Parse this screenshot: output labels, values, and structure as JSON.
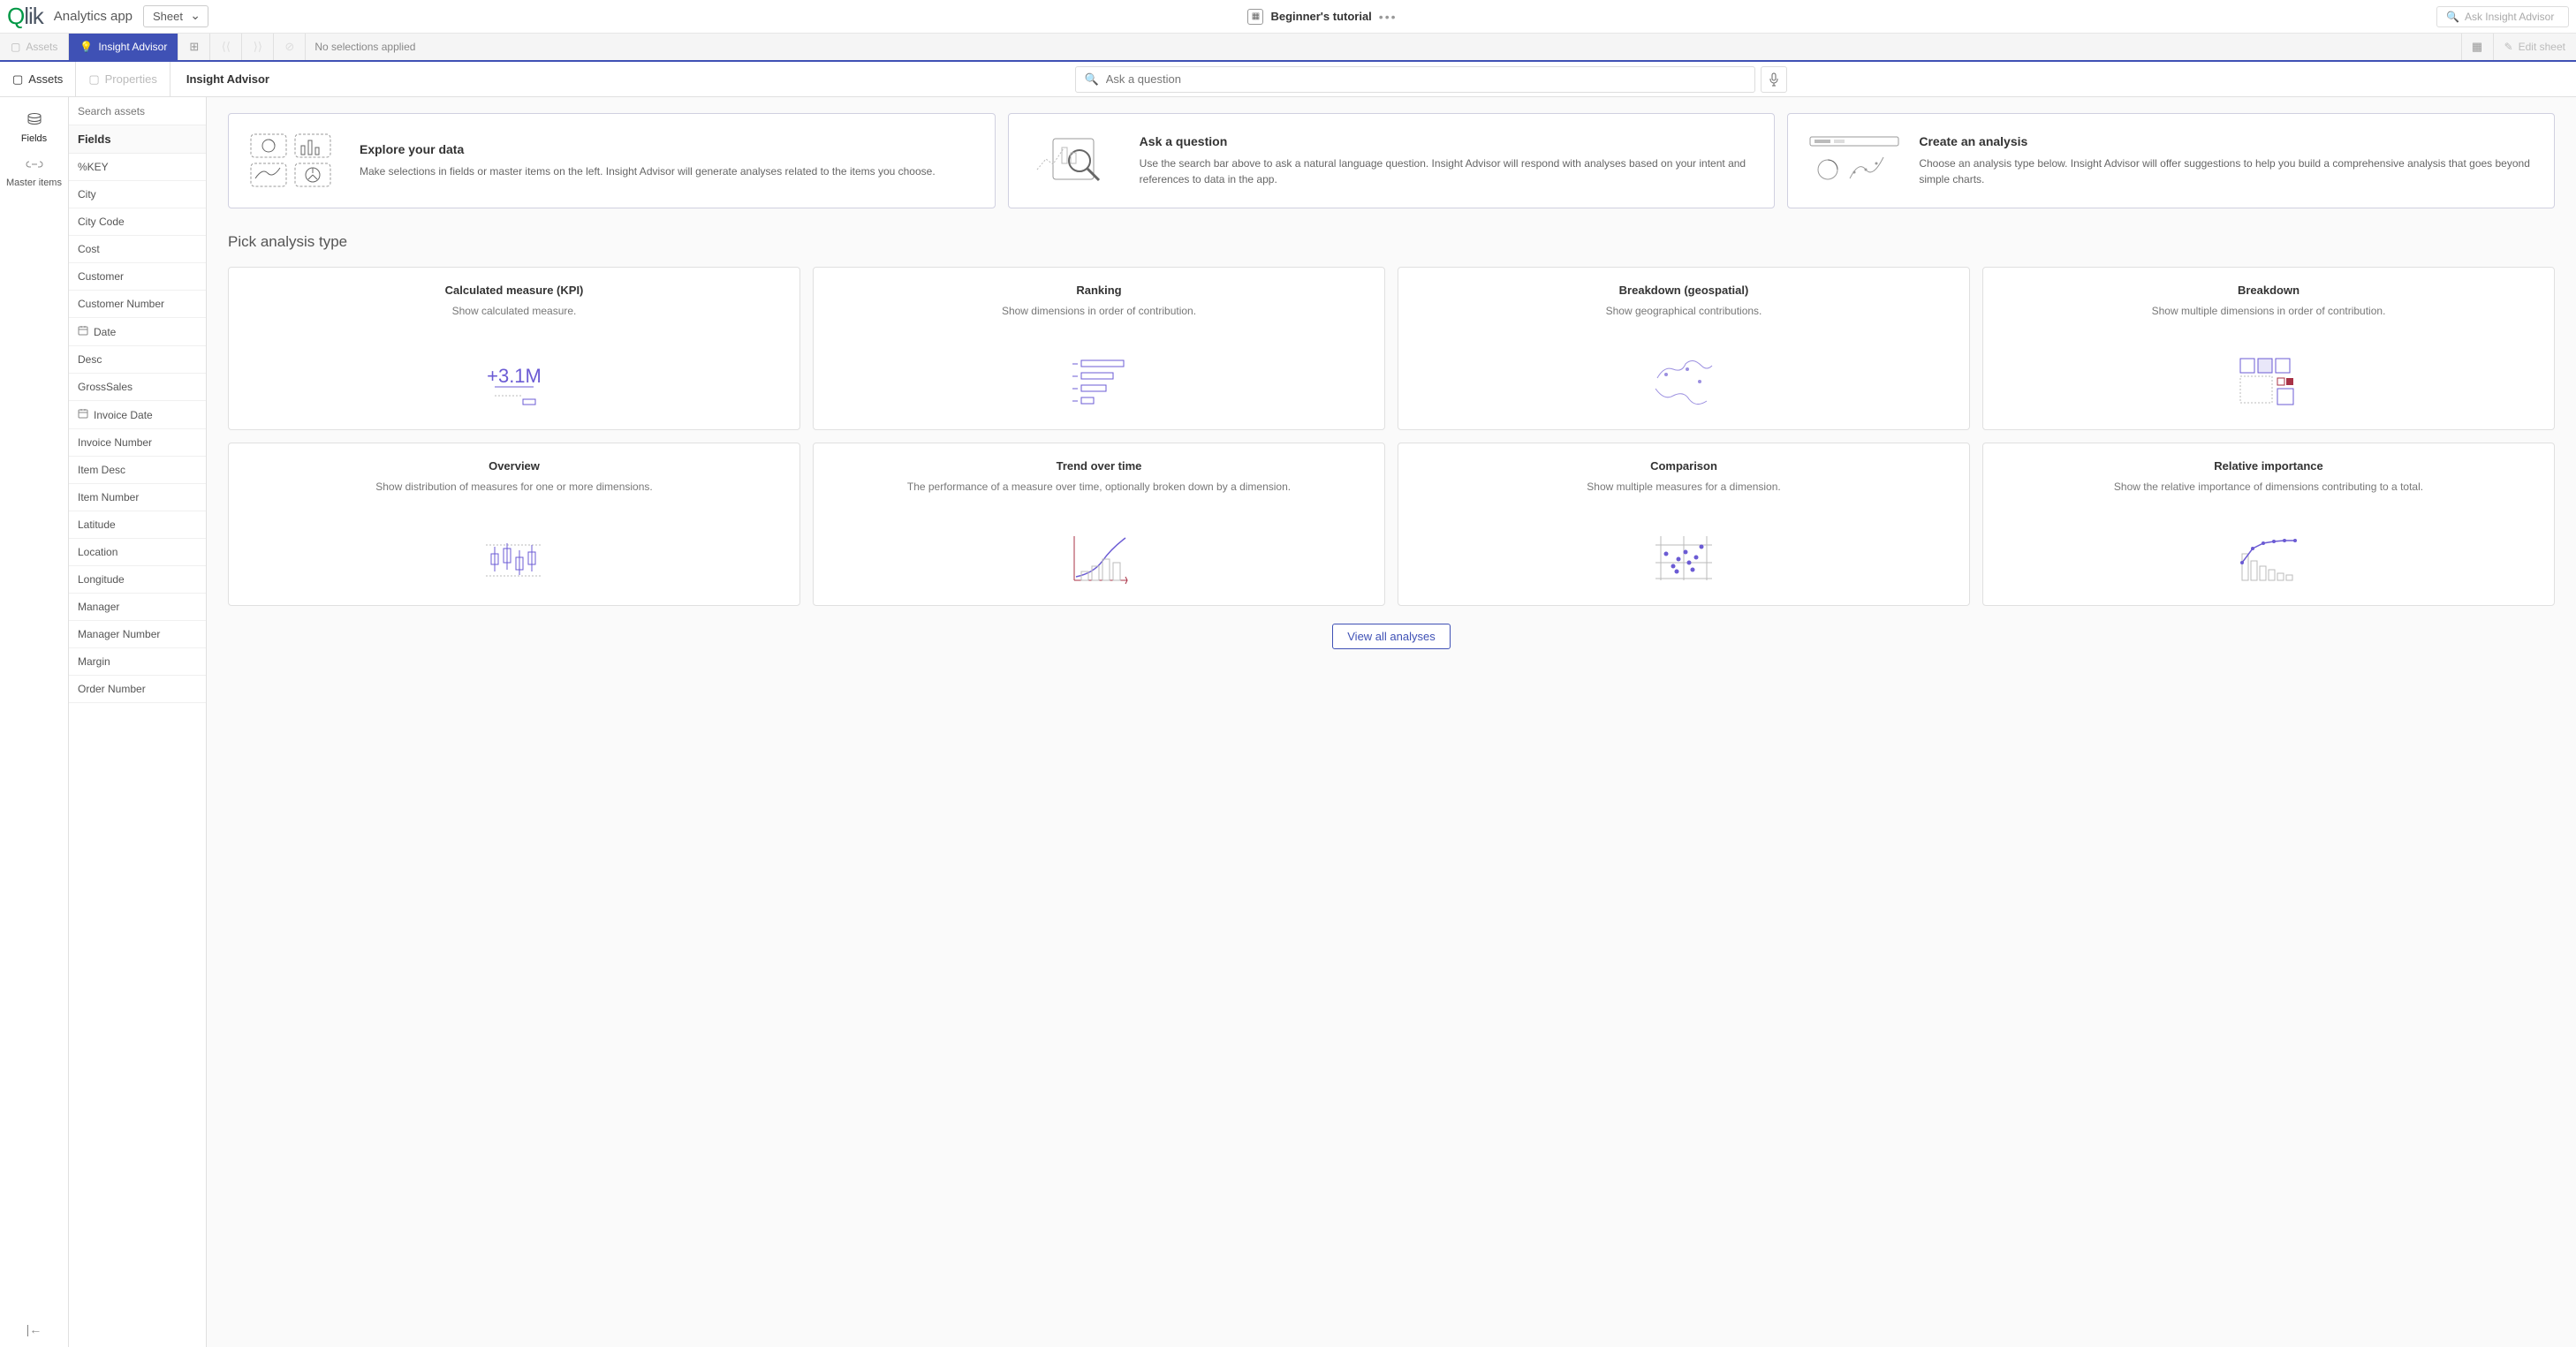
{
  "topbar": {
    "logo": "Qlik",
    "app_name": "Analytics app",
    "sheet_label": "Sheet",
    "tutorial_title": "Beginner's tutorial",
    "ask_advisor_placeholder": "Ask Insight Advisor"
  },
  "toolbar": {
    "assets": "Assets",
    "insight_advisor": "Insight Advisor",
    "no_selections": "No selections applied",
    "edit_sheet": "Edit sheet"
  },
  "subheader": {
    "assets": "Assets",
    "properties": "Properties",
    "insight_label": "Insight Advisor",
    "question_placeholder": "Ask a question"
  },
  "left_rail": {
    "fields": "Fields",
    "master_items": "Master items"
  },
  "fields_panel": {
    "search_placeholder": "Search assets",
    "header": "Fields",
    "items": [
      {
        "label": "%KEY",
        "icon": ""
      },
      {
        "label": "City",
        "icon": ""
      },
      {
        "label": "City Code",
        "icon": ""
      },
      {
        "label": "Cost",
        "icon": ""
      },
      {
        "label": "Customer",
        "icon": ""
      },
      {
        "label": "Customer Number",
        "icon": ""
      },
      {
        "label": "Date",
        "icon": "date"
      },
      {
        "label": "Desc",
        "icon": ""
      },
      {
        "label": "GrossSales",
        "icon": ""
      },
      {
        "label": "Invoice Date",
        "icon": "date"
      },
      {
        "label": "Invoice Number",
        "icon": ""
      },
      {
        "label": "Item Desc",
        "icon": ""
      },
      {
        "label": "Item Number",
        "icon": ""
      },
      {
        "label": "Latitude",
        "icon": ""
      },
      {
        "label": "Location",
        "icon": ""
      },
      {
        "label": "Longitude",
        "icon": ""
      },
      {
        "label": "Manager",
        "icon": ""
      },
      {
        "label": "Manager Number",
        "icon": ""
      },
      {
        "label": "Margin",
        "icon": ""
      },
      {
        "label": "Order Number",
        "icon": ""
      }
    ]
  },
  "hero": [
    {
      "title": "Explore your data",
      "desc": "Make selections in fields or master items on the left. Insight Advisor will generate analyses related to the items you choose."
    },
    {
      "title": "Ask a question",
      "desc": "Use the search bar above to ask a natural language question. Insight Advisor will respond with analyses based on your intent and references to data in the app."
    },
    {
      "title": "Create an analysis",
      "desc": "Choose an analysis type below. Insight Advisor will offer suggestions to help you build a comprehensive analysis that goes beyond simple charts."
    }
  ],
  "section_title": "Pick analysis type",
  "analyses": [
    {
      "title": "Calculated measure (KPI)",
      "desc": "Show calculated measure."
    },
    {
      "title": "Ranking",
      "desc": "Show dimensions in order of contribution."
    },
    {
      "title": "Breakdown (geospatial)",
      "desc": "Show geographical contributions."
    },
    {
      "title": "Breakdown",
      "desc": "Show multiple dimensions in order of contribution."
    },
    {
      "title": "Overview",
      "desc": "Show distribution of measures for one or more dimensions."
    },
    {
      "title": "Trend over time",
      "desc": "The performance of a measure over time, optionally broken down by a dimension."
    },
    {
      "title": "Comparison",
      "desc": "Show multiple measures for a dimension."
    },
    {
      "title": "Relative importance",
      "desc": "Show the relative importance of dimensions contributing to a total."
    }
  ],
  "view_all": "View all analyses"
}
